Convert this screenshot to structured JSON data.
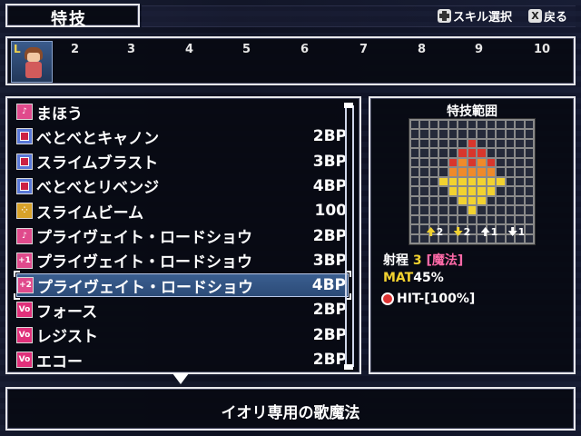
{
  "header": {
    "title": "特技",
    "hint_select_label": "スキル選択",
    "hint_back_label": "戻る",
    "hint_back_button": "X"
  },
  "levels": [
    "2",
    "3",
    "4",
    "5",
    "6",
    "7",
    "8",
    "9",
    "10"
  ],
  "skills": [
    {
      "name": "まほう",
      "cost": "",
      "icon": "music-icon",
      "color": "#e04a8c"
    },
    {
      "name": "べとべとキャノン",
      "cost": "2BP",
      "icon": "skill-square-icon",
      "color": "#5a78d8"
    },
    {
      "name": "スライムブラスト",
      "cost": "3BP",
      "icon": "skill-square-icon",
      "color": "#5a78d8"
    },
    {
      "name": "べとべとリベンジ",
      "cost": "4BP",
      "icon": "skill-square-icon",
      "color": "#5a78d8"
    },
    {
      "name": "スライムビーム",
      "cost": "100",
      "icon": "dots-icon",
      "color": "#d8a22a"
    },
    {
      "name": "プライヴェイト・ロードショウ",
      "cost": "2BP",
      "icon": "music-note-icon",
      "color": "#e04a8c"
    },
    {
      "name": "プライヴェイト・ロードショウ",
      "cost": "3BP",
      "icon": "music-note-plus1-icon",
      "color": "#e04a8c"
    },
    {
      "name": "プライヴェイト・ロードショウ",
      "cost": "4BP",
      "icon": "music-note-plus2-icon",
      "color": "#e04a8c"
    },
    {
      "name": "フォース",
      "cost": "2BP",
      "icon": "vo-icon",
      "color": "#e0307a"
    },
    {
      "name": "レジスト",
      "cost": "2BP",
      "icon": "vo-icon",
      "color": "#e0307a"
    },
    {
      "name": "エコー",
      "cost": "2BP",
      "icon": "vo-icon",
      "color": "#e0307a"
    }
  ],
  "icon_glyphs": {
    "music": "♪",
    "vo": "Vo",
    "plus1": "+1",
    "plus2": "+2",
    "dots": "⁘"
  },
  "selected_index": 7,
  "range": {
    "title": "特技範囲",
    "modifiers": [
      "2",
      "2",
      "1",
      "1"
    ],
    "range_label": "射程",
    "range_value": "3",
    "range_type": "[魔法]",
    "mat_label": "MAT",
    "mat_value": "45%",
    "hit_label": "HIT-[100%]"
  },
  "description": "イオリ専用の歌魔法",
  "colors": {
    "red": "#d8362c",
    "orange": "#ef8a2a",
    "yellow": "#f2d230"
  }
}
